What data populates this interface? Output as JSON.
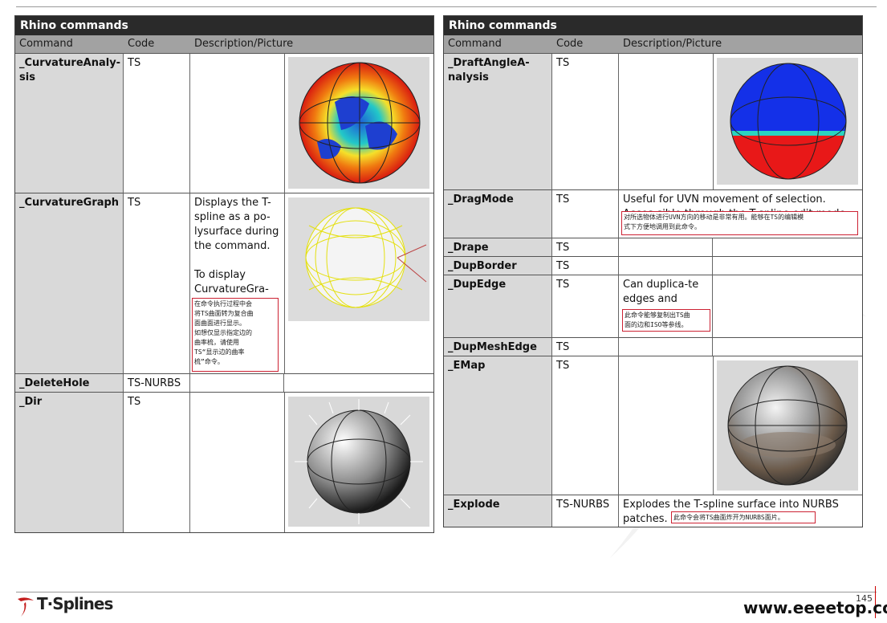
{
  "left": {
    "title": "Rhino commands",
    "headers": {
      "command": "Command",
      "code": "Code",
      "description": "Description/Picture"
    },
    "rows": [
      {
        "command": "_CurvatureAnaly-sis",
        "code": "TS",
        "description": ""
      },
      {
        "command": "_CurvatureGraph",
        "code": "TS",
        "description": "Displays the T-spline as a po-lysurface during the command.\n\nTo display CurvatureGra-",
        "note": "在命令执行过程中会\n将TS曲面转为复合曲\n面曲面进行显示。\n如想仅显示指定边的\n曲率梳，请使用\nTS“显示边的曲率\n梳”命令。"
      },
      {
        "command": "_DeleteHole",
        "code": "TS-NURBS",
        "description": ""
      },
      {
        "command": "_Dir",
        "code": "TS",
        "description": ""
      }
    ]
  },
  "right": {
    "title": "Rhino commands",
    "headers": {
      "command": "Command",
      "code": "Code",
      "description": "Description/Picture"
    },
    "rows": [
      {
        "command": "_DraftAngleA-nalysis",
        "code": "TS",
        "description": ""
      },
      {
        "command": "_DragMode",
        "code": "TS",
        "description": "Useful for UVN movement of selection. Acces-sible through the T-spline edit mode heads",
        "note": "对所选物体进行UVN方向的移动是非常有用。能够在TS的编辑模\n式下方便地调用到此命令。"
      },
      {
        "command": "_Drape",
        "code": "TS",
        "description": ""
      },
      {
        "command": "_DupBorder",
        "code": "TS",
        "description": ""
      },
      {
        "command": "_DupEdge",
        "code": "TS",
        "description": "Can duplica-te edges and",
        "note": "此命令能够复制出TS曲\n面的边和ISO等参线。"
      },
      {
        "command": "_DupMeshEdge",
        "code": "TS",
        "description": ""
      },
      {
        "command": "_EMap",
        "code": "TS",
        "description": ""
      },
      {
        "command": "_Explode",
        "code": "TS-NURBS",
        "description": "Explodes the T-spline surface into NURBS patches.",
        "note": "此命令会将TS曲面炸开为NURBS面片。"
      }
    ]
  },
  "footer": {
    "brand": "T·Splines",
    "page": "145",
    "site": "www.eeeetop.com"
  }
}
